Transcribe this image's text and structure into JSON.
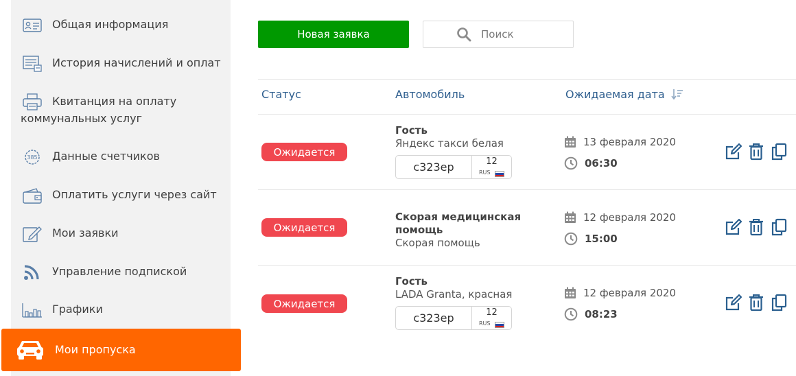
{
  "sidebar": {
    "items": [
      {
        "label": "Общая информация",
        "icon": "id-card-icon"
      },
      {
        "label": "История начислений и оплат",
        "icon": "invoice-history-icon"
      },
      {
        "label": "Квитанция на оплату коммунальных услуг",
        "icon": "printer-icon"
      },
      {
        "label": "Данные счетчиков",
        "icon": "meter-icon"
      },
      {
        "label": "Оплатить услуги через сайт",
        "icon": "wallet-icon"
      },
      {
        "label": "Мои заявки",
        "icon": "edit-note-icon"
      },
      {
        "label": "Управление подпиской",
        "icon": "rss-icon"
      },
      {
        "label": "Графики",
        "icon": "bar-chart-icon"
      }
    ],
    "active": {
      "label": "Мои пропуска",
      "icon": "car-icon"
    }
  },
  "toolbar": {
    "new_request_label": "Новая заявка",
    "search_placeholder": "Поиск"
  },
  "table": {
    "headers": {
      "status": "Статус",
      "car": "Автомобиль",
      "date": "Ожидаемая дата"
    },
    "rows": [
      {
        "status": "Ожидается",
        "owner": "Гость",
        "car": "Яндекс такси белая",
        "plate": "с323ер",
        "region": "12",
        "country": "RUS",
        "date": "13 февраля 2020",
        "time": "06:30"
      },
      {
        "status": "Ожидается",
        "owner": "Скорая медицинская помощь",
        "car": "Скорая помощь",
        "plate": "",
        "region": "",
        "country": "",
        "date": "12 февраля 2020",
        "time": "15:00"
      },
      {
        "status": "Ожидается",
        "owner": "Гость",
        "car": "LADA Granta, красная",
        "plate": "с323ер",
        "region": "12",
        "country": "RUS",
        "date": "12 февраля 2020",
        "time": "08:23"
      }
    ]
  },
  "colors": {
    "accent": "#ff6600",
    "primary_button": "#009900",
    "status_badge": "#f0474f",
    "header_text": "#2f5f8f",
    "action_icon": "#2a5f8f"
  }
}
